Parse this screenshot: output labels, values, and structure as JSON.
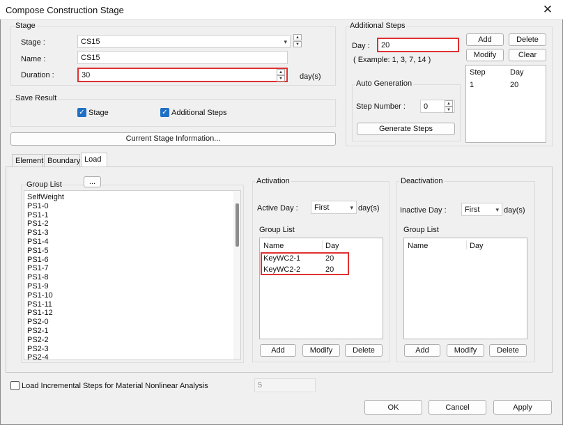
{
  "window": {
    "title": "Compose Construction Stage",
    "close_glyph": "✕"
  },
  "stage": {
    "group_label": "Stage",
    "stage_label": "Stage :",
    "stage_value": "CS15",
    "name_label": "Name :",
    "name_value": "CS15",
    "duration_label": "Duration :",
    "duration_value": "30",
    "duration_unit": "day(s)"
  },
  "save_result": {
    "group_label": "Save Result",
    "stage_label": "Stage",
    "stage_checked": true,
    "additional_label": "Additional Steps",
    "additional_checked": true
  },
  "current_stage_button": "Current Stage Information...",
  "additional_steps": {
    "group_label": "Additional Steps",
    "day_label": "Day :",
    "day_value": "20",
    "example": "( Example: 1, 3, 7, 14 )",
    "add": "Add",
    "delete": "Delete",
    "modify": "Modify",
    "clear": "Clear",
    "columns": [
      "Step",
      "Day"
    ],
    "rows": [
      {
        "step": "1",
        "day": "20"
      }
    ],
    "auto_generation": {
      "group_label": "Auto Generation",
      "step_number_label": "Step Number :",
      "step_number_value": "0",
      "generate_button": "Generate Steps"
    }
  },
  "tabs": [
    "Element",
    "Boundary",
    "Load"
  ],
  "active_tab": "Load",
  "load": {
    "group_list_label": "Group List",
    "ellipsis_button": "...",
    "groups": [
      "SelfWeight",
      "PS1-0",
      "PS1-1",
      "PS1-2",
      "PS1-3",
      "PS1-4",
      "PS1-5",
      "PS1-6",
      "PS1-7",
      "PS1-8",
      "PS1-9",
      "PS1-10",
      "PS1-11",
      "PS1-12",
      "PS2-0",
      "PS2-1",
      "PS2-2",
      "PS2-3",
      "PS2-4"
    ],
    "activation": {
      "group_label": "Activation",
      "day_label": "Active Day :",
      "day_value": "First",
      "unit": "day(s)",
      "list_label": "Group List",
      "columns": [
        "Name",
        "Day"
      ],
      "rows": [
        {
          "name": "KeyWC2-1",
          "day": "20"
        },
        {
          "name": "KeyWC2-2",
          "day": "20"
        }
      ],
      "add": "Add",
      "modify": "Modify",
      "delete": "Delete"
    },
    "deactivation": {
      "group_label": "Deactivation",
      "day_label": "Inactive Day :",
      "day_value": "First",
      "unit": "day(s)",
      "list_label": "Group List",
      "columns": [
        "Name",
        "Day"
      ],
      "rows": [],
      "add": "Add",
      "modify": "Modify",
      "delete": "Delete"
    }
  },
  "incremental": {
    "label": "Load Incremental Steps for Material Nonlinear Analysis",
    "checked": false,
    "value": "5"
  },
  "footer": {
    "ok": "OK",
    "cancel": "Cancel",
    "apply": "Apply"
  },
  "icons": {
    "check": "✓",
    "down": "▾",
    "up_small": "▲",
    "down_small": "▼"
  }
}
